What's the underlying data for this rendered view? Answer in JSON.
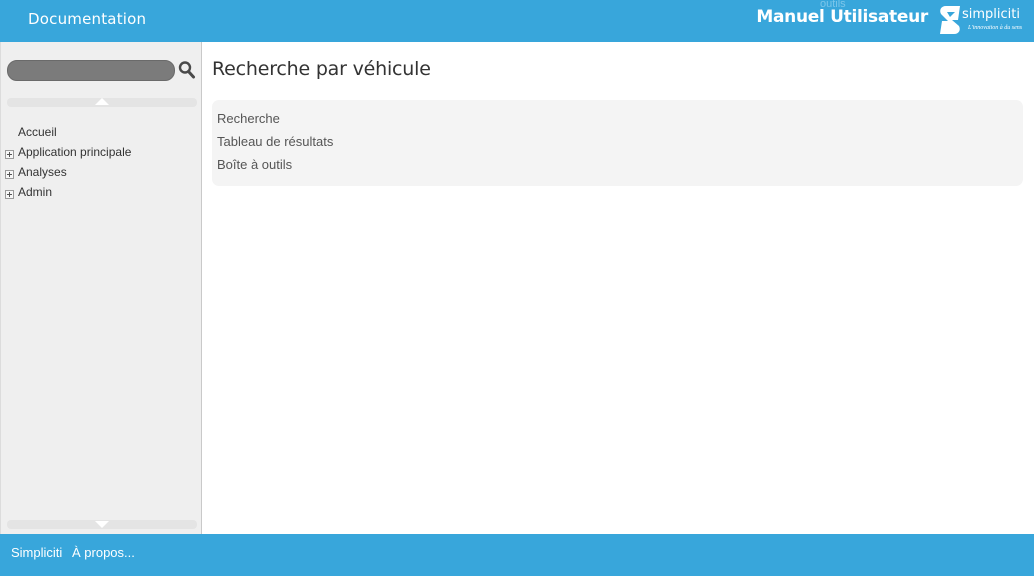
{
  "header": {
    "doc_title": "Documentation",
    "manual_title": "Manuel Utilisateur",
    "ghost_link": "outils",
    "brand": {
      "name": "simpliciti",
      "tagline": "L'innovation à du sens",
      "logo_icon": "simpliciti-s-logo"
    }
  },
  "colors": {
    "accent": "#38a6db",
    "sidebar_bg": "#efefef",
    "toc_bg": "#f4f4f4"
  },
  "sidebar": {
    "search": {
      "value": "",
      "placeholder": "",
      "icon": "search-icon"
    },
    "items": [
      {
        "label": "Accueil",
        "expandable": false
      },
      {
        "label": "Application principale",
        "expandable": true
      },
      {
        "label": "Analyses",
        "expandable": true
      },
      {
        "label": "Admin",
        "expandable": true
      }
    ]
  },
  "main": {
    "title": "Recherche par véhicule",
    "toc": [
      {
        "label": "Recherche"
      },
      {
        "label": "Tableau de résultats"
      },
      {
        "label": "Boîte à outils"
      }
    ]
  },
  "footer": {
    "links": [
      {
        "label": "Simpliciti"
      },
      {
        "label": "À propos..."
      }
    ]
  }
}
